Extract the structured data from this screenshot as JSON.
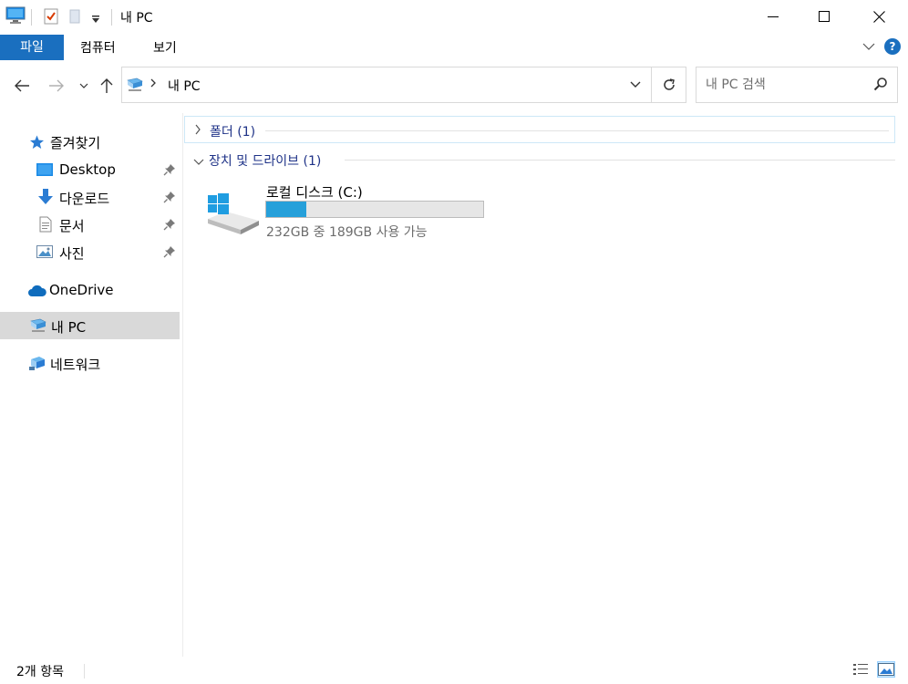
{
  "window": {
    "title": "내 PC",
    "minimize_icon": "minimize-icon",
    "maximize_icon": "maximize-icon",
    "close_icon": "close-icon"
  },
  "ribbon": {
    "tabs": [
      {
        "label": "파일",
        "active": true
      },
      {
        "label": "컴퓨터"
      },
      {
        "label": "보기"
      }
    ]
  },
  "address": {
    "path": "내 PC"
  },
  "search": {
    "placeholder": "내 PC 검색"
  },
  "sidebar": {
    "quick_access": "즐겨찾기",
    "items": [
      {
        "label": "Desktop",
        "pinned": true
      },
      {
        "label": "다운로드",
        "pinned": true
      },
      {
        "label": "문서",
        "pinned": true
      },
      {
        "label": "사진",
        "pinned": true
      }
    ],
    "onedrive": "OneDrive",
    "this_pc": "내 PC",
    "network": "네트워크"
  },
  "content": {
    "folders_group": {
      "label": "폴더",
      "count": "(1)"
    },
    "devices_group": {
      "label": "장치 및 드라이브",
      "count": "(1)"
    },
    "drive": {
      "name": "로컬 디스크 (C:)",
      "info": "232GB 중 189GB 사용 가능",
      "used_fraction": 0.185
    }
  },
  "status": {
    "item_count": "2개 항목"
  },
  "colors": {
    "accent": "#1a6fbf",
    "bar_fill": "#26a0da",
    "group_label": "#1e3287"
  }
}
